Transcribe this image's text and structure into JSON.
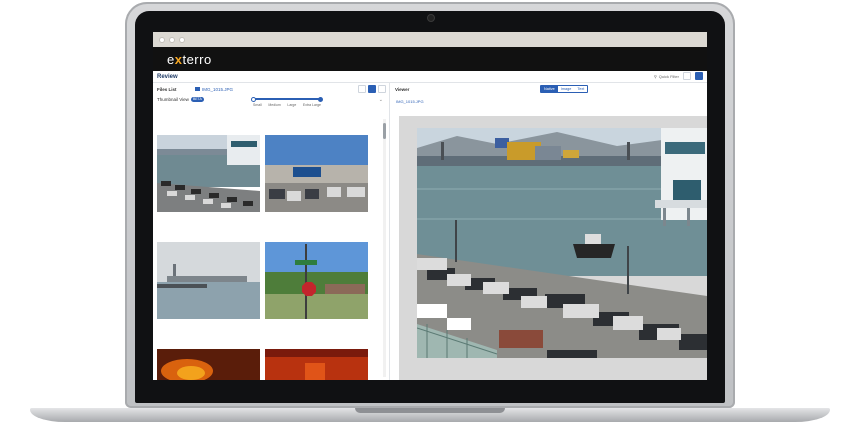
{
  "app": {
    "logo_prefix": "e",
    "logo_x": "x",
    "logo_suffix": "terro"
  },
  "review": {
    "title": "Review",
    "quick_filter": "Quick Filter"
  },
  "files": {
    "label": "Files List",
    "selected_file": "IMG_1015.JPG"
  },
  "thumbnail": {
    "label": "Thumbnail View",
    "badge": "BETA",
    "sizes": [
      "Small",
      "Medium",
      "Large",
      "Extra Large"
    ]
  },
  "viewer": {
    "label": "Viewer",
    "modes": [
      "Native",
      "Image",
      "Text"
    ],
    "active_mode": "Native",
    "file": "IMG_1015.JPG"
  },
  "colors": {
    "accent": "#2b5fb4",
    "header_bg": "#111111",
    "logo_accent": "#f5a623"
  }
}
